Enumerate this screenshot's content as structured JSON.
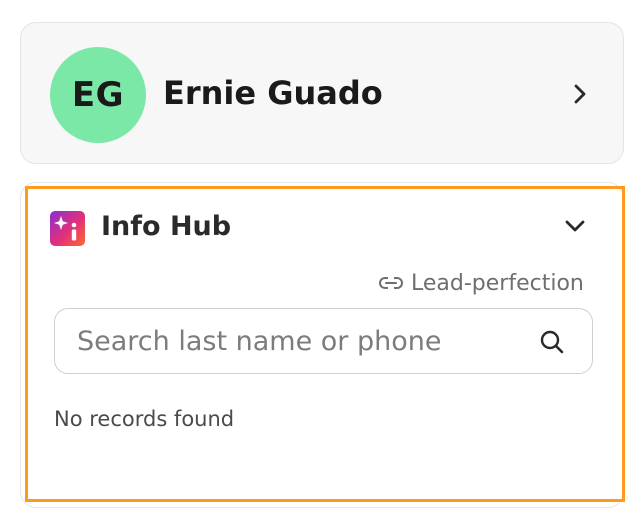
{
  "profile": {
    "initials": "EG",
    "name": "Ernie Guado",
    "avatar_color": "#7be8a8",
    "action_icon": "chevron-right-icon"
  },
  "info_hub": {
    "title": "Info Hub",
    "logo_icon": "sparkle-i-logo-icon",
    "collapse_icon": "chevron-down-icon",
    "link_label": "Lead-perfection",
    "link_icon": "link-icon",
    "search": {
      "placeholder": "Search last name or phone",
      "value": "",
      "icon": "search-icon"
    },
    "empty_message": "No records found",
    "highlight_color": "#ff9a1f"
  }
}
